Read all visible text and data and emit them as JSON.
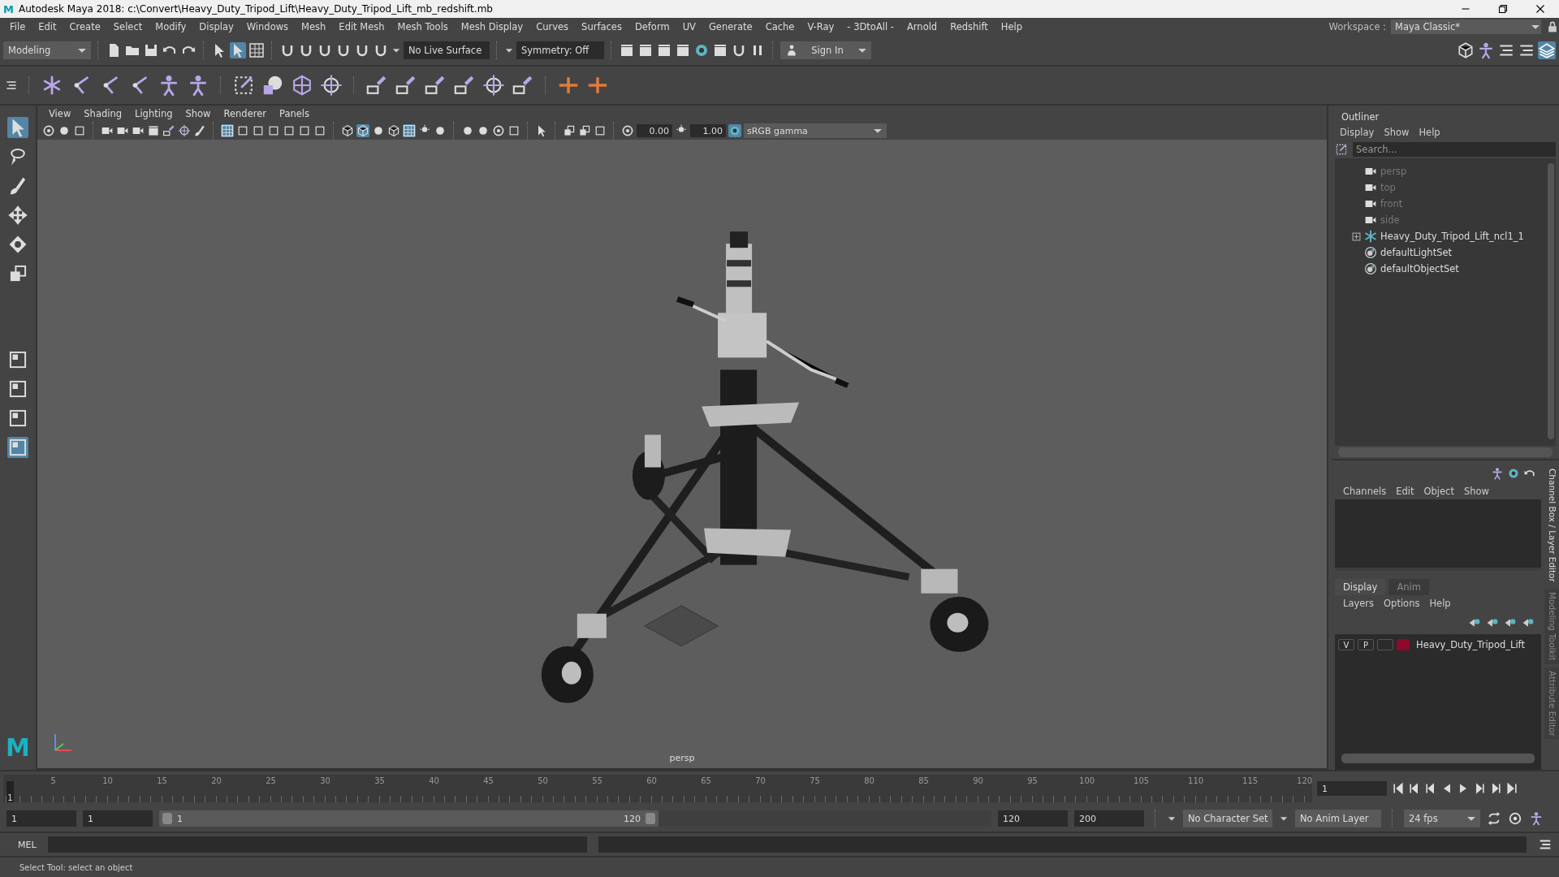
{
  "window": {
    "app_icon": "M",
    "title": "Autodesk Maya 2018: c:\\Convert\\Heavy_Duty_Tripod_Lift\\Heavy_Duty_Tripod_Lift_mb_redshift.mb"
  },
  "menu_bar": [
    "File",
    "Edit",
    "Create",
    "Select",
    "Modify",
    "Display",
    "Windows",
    "Mesh",
    "Edit Mesh",
    "Mesh Tools",
    "Mesh Display",
    "Curves",
    "Surfaces",
    "Deform",
    "UV",
    "Generate",
    "Cache",
    "V-Ray",
    "- 3DtoAll -",
    "Arnold",
    "Redshift",
    "Help"
  ],
  "workspace": {
    "label": "Workspace :",
    "value": "Maya Classic*"
  },
  "status_line": {
    "mode": "Modeling",
    "live_surface": "No Live Surface",
    "symmetry": "Symmetry: Off",
    "sign_in": "Sign In"
  },
  "toolbox": {
    "logo": "M"
  },
  "viewport": {
    "menus": [
      "View",
      "Shading",
      "Lighting",
      "Show",
      "Renderer",
      "Panels"
    ],
    "exposure": "0.00",
    "gamma": "1.00",
    "color_space": "sRGB gamma",
    "camera_label": "persp"
  },
  "outliner": {
    "title": "Outliner",
    "menus": [
      "Display",
      "Show",
      "Help"
    ],
    "search": {
      "placeholder": "Search..."
    },
    "items": [
      {
        "label": "persp",
        "kind": "camera",
        "dimmed": true,
        "expander": false
      },
      {
        "label": "top",
        "kind": "camera",
        "dimmed": true,
        "expander": false
      },
      {
        "label": "front",
        "kind": "camera",
        "dimmed": true,
        "expander": false
      },
      {
        "label": "side",
        "kind": "camera",
        "dimmed": true,
        "expander": false
      },
      {
        "label": "Heavy_Duty_Tripod_Lift_ncl1_1",
        "kind": "group",
        "dimmed": false,
        "expander": true
      },
      {
        "label": "defaultLightSet",
        "kind": "set",
        "dimmed": false,
        "expander": false
      },
      {
        "label": "defaultObjectSet",
        "kind": "set",
        "dimmed": false,
        "expander": false
      }
    ]
  },
  "channel_box": {
    "menus": [
      "Channels",
      "Edit",
      "Object",
      "Show"
    ]
  },
  "layer_editor": {
    "tabs": [
      {
        "label": "Display",
        "selected": true
      },
      {
        "label": "Anim",
        "selected": false
      }
    ],
    "menus": [
      "Layers",
      "Options",
      "Help"
    ],
    "layers": [
      {
        "visibility": "V",
        "playback": "P",
        "name": "Heavy_Duty_Tripod_Lift",
        "color": "#8c0a2a"
      }
    ]
  },
  "side_tabs": [
    {
      "label": "Channel Box / Layer Editor",
      "selected": true
    },
    {
      "label": "Modeling Toolkit",
      "selected": false
    },
    {
      "label": "Attribute Editor",
      "selected": false
    }
  ],
  "timeline": {
    "ticks": [
      "5",
      "10",
      "15",
      "20",
      "25",
      "30",
      "35",
      "40",
      "45",
      "50",
      "55",
      "60",
      "65",
      "70",
      "75",
      "80",
      "85",
      "90",
      "95",
      "100",
      "105",
      "110",
      "115",
      "120"
    ],
    "current_marker": "1",
    "current_frame": "1"
  },
  "range": {
    "start": "1",
    "playback_start": "1",
    "slider_start": "1",
    "slider_end": "120",
    "playback_end": "120",
    "end": "200",
    "level": 0.6,
    "character_set": "No Character Set",
    "anim_layer": "No Anim Layer",
    "fps": "24 fps"
  },
  "command_line": {
    "label": "MEL"
  },
  "help_line": "Select Tool: select an object"
}
